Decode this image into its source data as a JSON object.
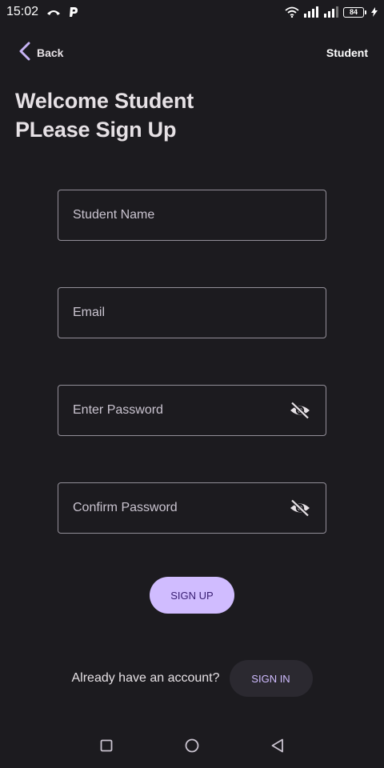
{
  "status_bar": {
    "time": "15:02",
    "battery_level": "84",
    "icons": [
      "call-icon",
      "p-app-icon",
      "wifi-icon",
      "signal-icon",
      "signal-icon",
      "battery-icon",
      "charging-icon"
    ]
  },
  "top_bar": {
    "back_label": "Back",
    "role_label": "Student"
  },
  "heading": {
    "line1": "Welcome Student",
    "line2": "PLease Sign Up"
  },
  "form": {
    "student_name_placeholder": "Student Name",
    "email_placeholder": "Email",
    "password_placeholder": "Enter Password",
    "confirm_password_placeholder": "Confirm Password"
  },
  "actions": {
    "signup_label": "SIGN UP",
    "signin_prompt": "Already have an account?",
    "signin_label": "SIGN IN"
  },
  "colors": {
    "background": "#1c1b1f",
    "accent": "#d0bcff",
    "outline": "#938f99",
    "on_accent": "#381e72"
  }
}
